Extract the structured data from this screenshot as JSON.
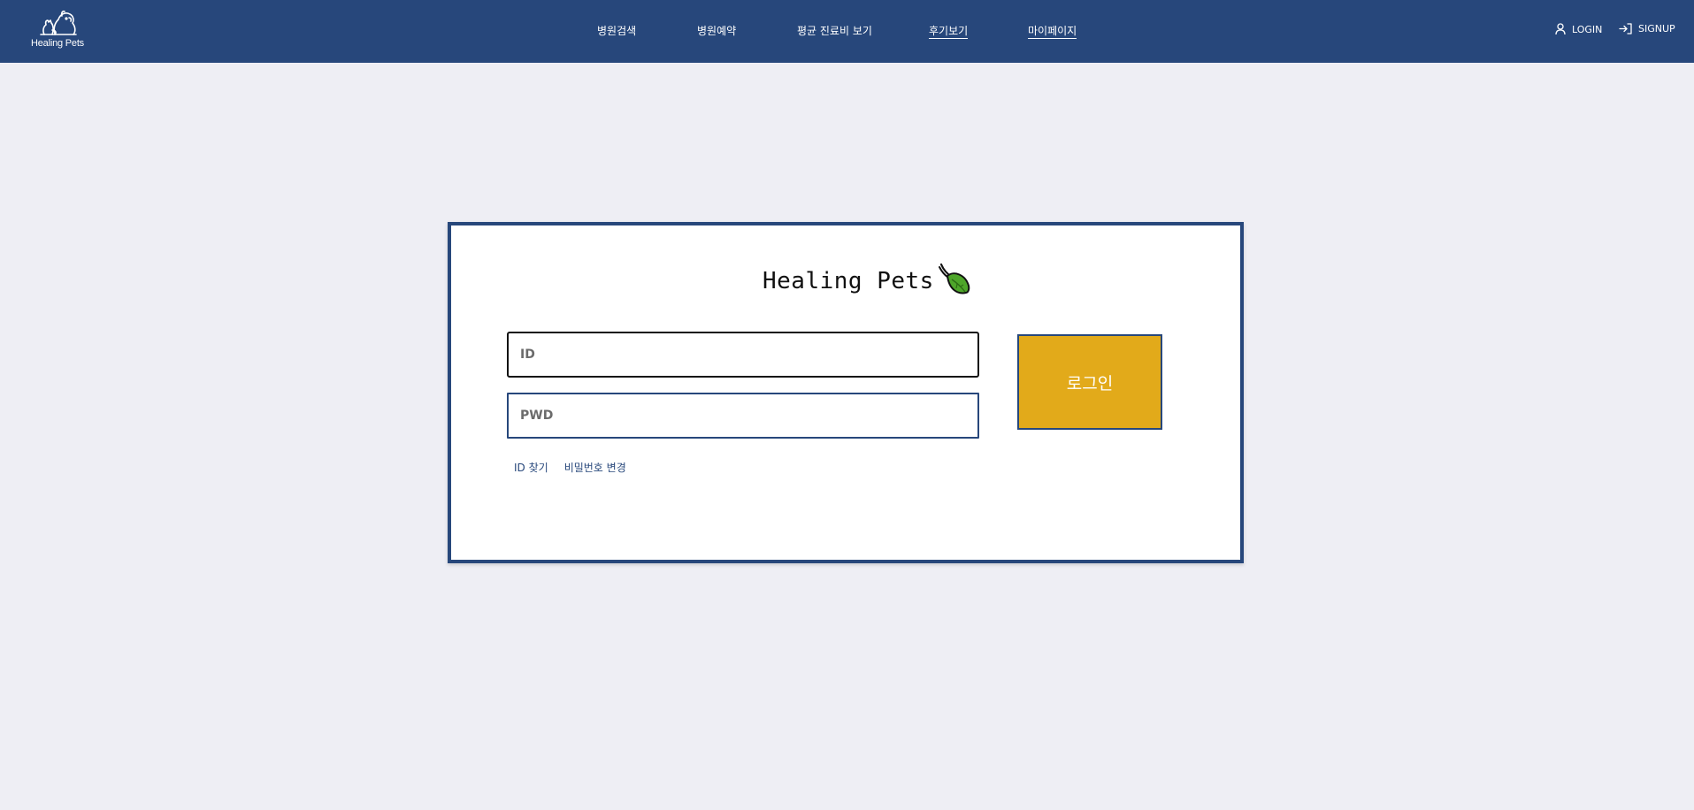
{
  "header": {
    "logo_text": "Healing Pets",
    "nav": [
      {
        "label": "병원검색"
      },
      {
        "label": "병원예약"
      },
      {
        "label": "평균 진료비 보기"
      },
      {
        "label": "후기보기"
      },
      {
        "label": "마이페이지"
      }
    ],
    "login_label": "LOGIN",
    "signup_label": "SIGNUP"
  },
  "login_card": {
    "brand_title": "Healing Pets",
    "id_placeholder": "ID",
    "pwd_placeholder": "PWD",
    "login_button": "로그인",
    "find_id": "ID 찾기",
    "change_password": "비밀번호 변경"
  },
  "colors": {
    "header_bg": "#27477b",
    "page_bg": "#eeeef4",
    "button_bg": "#e2aa1a"
  },
  "icons": {
    "logo": "dog-cat-logo-icon",
    "brand": "leaf-icon",
    "login": "user-icon",
    "signup": "sign-in-arrow-icon"
  }
}
